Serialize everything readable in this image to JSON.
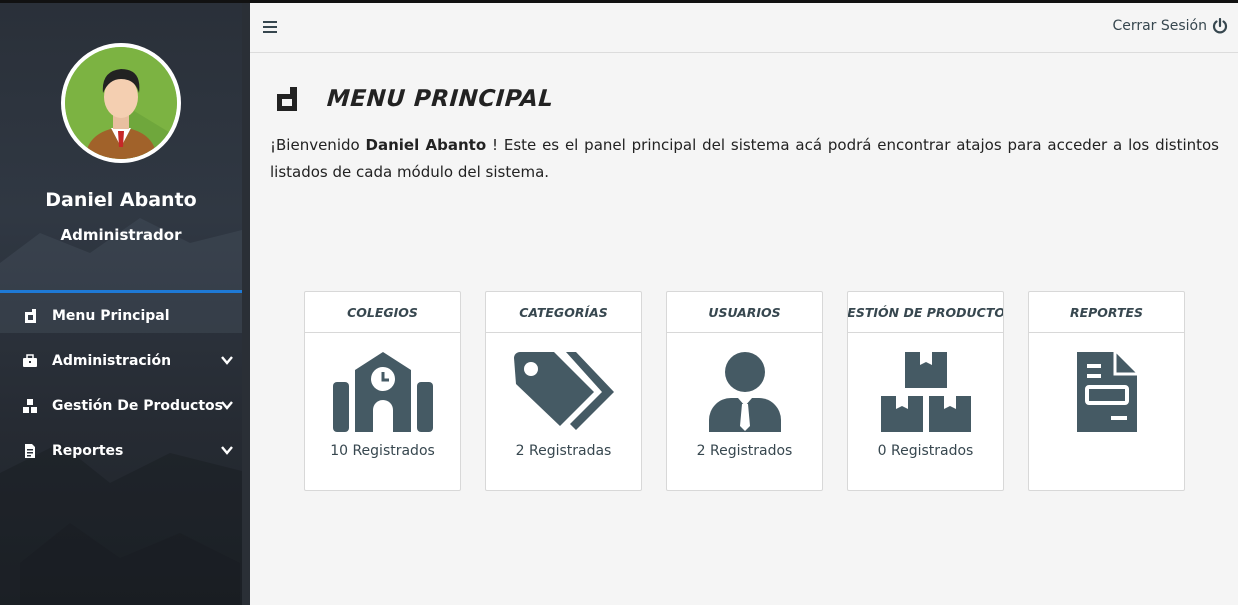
{
  "sidebar": {
    "user_name": "Daniel Abanto",
    "user_role": "Administrador",
    "items": [
      {
        "label": "Menu Principal"
      },
      {
        "label": "Administración"
      },
      {
        "label": "Gestión De Productos"
      },
      {
        "label": "Reportes"
      }
    ]
  },
  "header": {
    "logout_label": "Cerrar Sesión"
  },
  "main": {
    "title": "MENU PRINCIPAL",
    "welcome_prefix": "¡Bienvenido ",
    "welcome_name": "Daniel Abanto",
    "welcome_suffix": " ! Este es el panel principal del sistema acá podrá encontrar atajos para acceder a los distintos listados de cada módulo del sistema.",
    "cards": [
      {
        "title": "COLEGIOS",
        "count": "10 Registrados",
        "icon": "school-icon"
      },
      {
        "title": "CATEGORÍAS",
        "count": "2 Registradas",
        "icon": "tags-icon"
      },
      {
        "title": "USUARIOS",
        "count": "2 Registrados",
        "icon": "user-tie-icon"
      },
      {
        "title": "GESTIÓN DE PRODUCTOS",
        "count": "0 Registrados",
        "icon": "boxes-icon"
      },
      {
        "title": "REPORTES",
        "count": "",
        "icon": "report-file-icon"
      }
    ]
  },
  "colors": {
    "accent": "#1e7ad6",
    "icon": "#455a64",
    "sidebar_bg": "#2a3039"
  }
}
